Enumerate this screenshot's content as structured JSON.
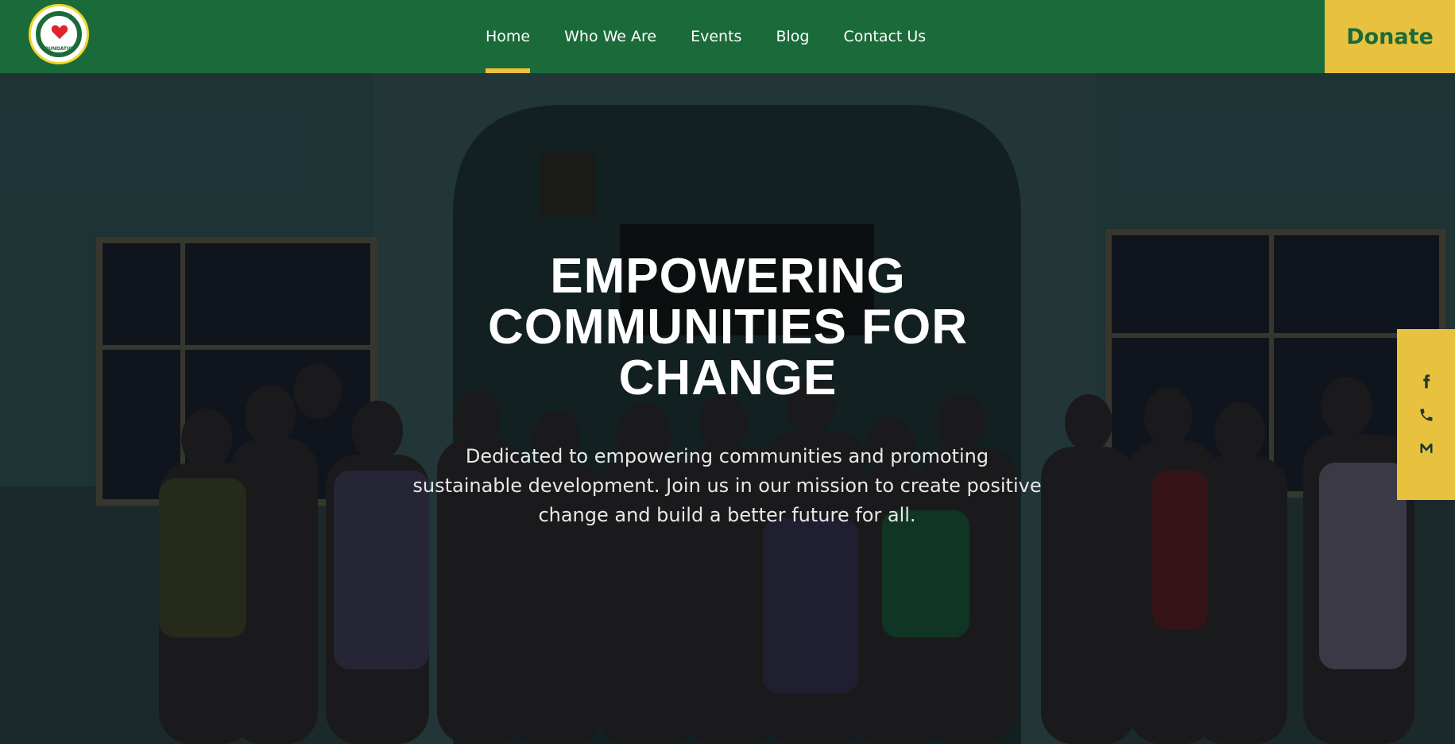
{
  "logo": {
    "name": "ZITA-ONYEKA FOUNDATION",
    "icon": "heart-hands-logo"
  },
  "nav": {
    "items": [
      {
        "label": "Home",
        "active": true
      },
      {
        "label": "Who We Are",
        "active": false
      },
      {
        "label": "Events",
        "active": false
      },
      {
        "label": "Blog",
        "active": false
      },
      {
        "label": "Contact Us",
        "active": false
      }
    ],
    "donate_label": "Donate"
  },
  "hero": {
    "headline_line1": "EMPOWERING",
    "headline_line2": "COMMUNITIES FOR",
    "headline_line3": "CHANGE",
    "subtext_line1": "Dedicated to empowering communities and promoting",
    "subtext_line2": "sustainable development. Join us in our mission to create positive",
    "subtext_line3": "change and build a better future for all."
  },
  "social": [
    {
      "icon": "facebook-icon"
    },
    {
      "icon": "phone-icon"
    },
    {
      "icon": "mail-icon"
    }
  ],
  "colors": {
    "nav_bg": "#1b6b3a",
    "accent_yellow": "#e8c23f",
    "active_underline": "#f0c33c",
    "text_white": "#ffffff"
  }
}
